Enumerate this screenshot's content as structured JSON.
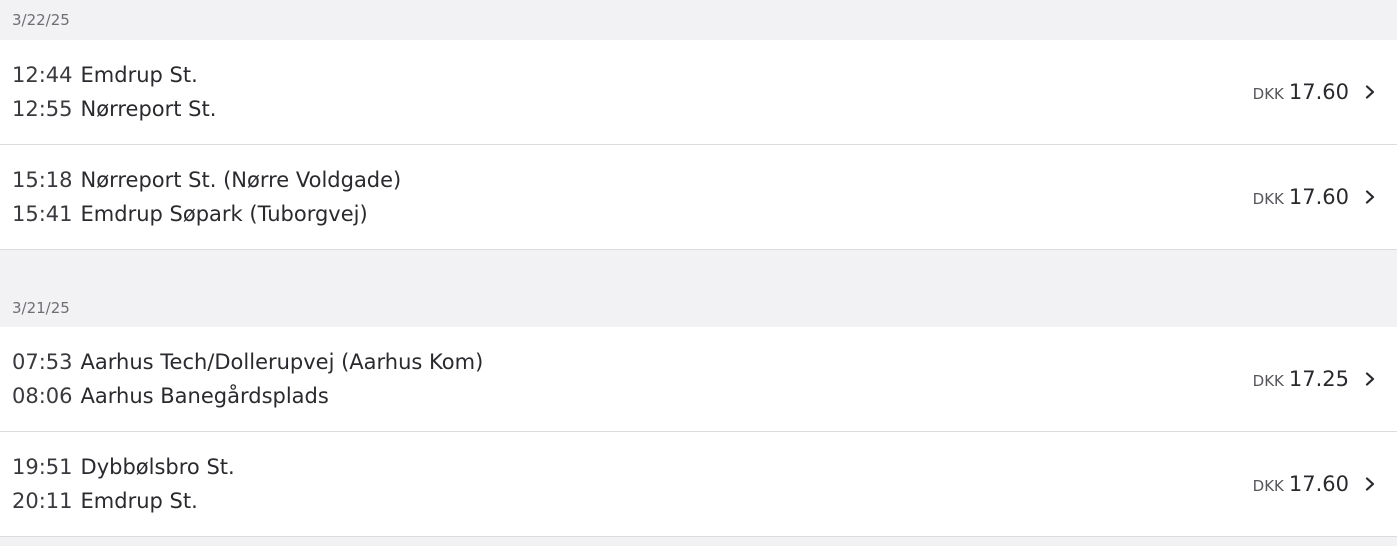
{
  "groups": [
    {
      "date": "3/22/25",
      "trips": [
        {
          "from_time": "12:44",
          "from_stop": "Emdrup St.",
          "to_time": "12:55",
          "to_stop": "Nørreport St.",
          "currency": "DKK",
          "price": "17.60",
          "icon": "chevron-right-icon"
        },
        {
          "from_time": "15:18",
          "from_stop": "Nørreport St. (Nørre Voldgade)",
          "to_time": "15:41",
          "to_stop": "Emdrup Søpark (Tuborgvej)",
          "currency": "DKK",
          "price": "17.60",
          "icon": "chevron-right-icon"
        }
      ]
    },
    {
      "date": "3/21/25",
      "trips": [
        {
          "from_time": "07:53",
          "from_stop": "Aarhus Tech/Dollerupvej (Aarhus Kom)",
          "to_time": "08:06",
          "to_stop": "Aarhus Banegårdsplads",
          "currency": "DKK",
          "price": "17.25",
          "icon": "chevron-right-icon"
        },
        {
          "from_time": "19:51",
          "from_stop": "Dybbølsbro St.",
          "to_time": "20:11",
          "to_stop": "Emdrup St.",
          "currency": "DKK",
          "price": "17.60",
          "icon": "chevron-right-icon"
        }
      ]
    }
  ],
  "colors": {
    "background": "#f2f2f4",
    "row": "#ffffff",
    "divider": "#dcdcdf",
    "text": "#2a2a2e",
    "muted": "#6e6e74"
  }
}
